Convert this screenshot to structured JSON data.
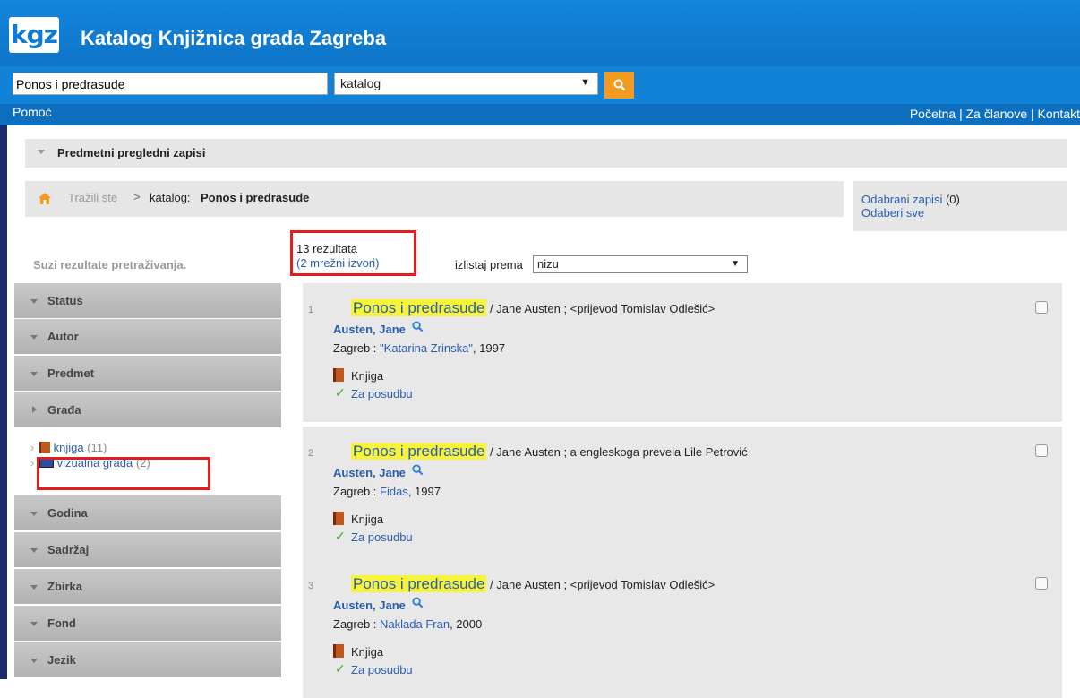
{
  "header": {
    "logo_text": "kgz",
    "title": "Katalog Knjižnica grada Zagreba"
  },
  "search": {
    "query": "Ponos i predrasude",
    "scope": "katalog",
    "button_icon": "search-icon"
  },
  "nav": {
    "help": "Pomoć",
    "links": "Početna | Za članove | Kontakt"
  },
  "subject_bar": {
    "label": "Predmetni pregledni zapisi"
  },
  "breadcrumb": {
    "prefix": "Tražili ste",
    "separator": ">",
    "scope": "katalog:",
    "term": "Ponos i predrasude"
  },
  "selection": {
    "selected_label": "Odabrani zapisi",
    "selected_count": "(0)",
    "select_all": "Odaberi sve"
  },
  "results": {
    "narrow_label": "Suzi rezultate pretraživanja.",
    "count": "13 rezultata",
    "network_sources": "(2 mrežni izvori)",
    "sort_label": "izlistaj prema",
    "sort_value": "nizu"
  },
  "facets": {
    "status": "Status",
    "autor": "Autor",
    "predmet": "Predmet",
    "grada": "Građa",
    "godina": "Godina",
    "sadrzaj": "Sadržaj",
    "zbirka": "Zbirka",
    "fond": "Fond",
    "jezik": "Jezik"
  },
  "grada_items": [
    {
      "label": "knjiga",
      "count": "(11)"
    },
    {
      "label": "vizualna građa",
      "count": "(2)"
    }
  ],
  "records": [
    {
      "num": "1",
      "title": "Ponos i predrasude",
      "statement": " / Jane Austen ; <prijevod Tomislav Odlešić>",
      "author": "Austen, Jane",
      "place": "Zagreb : ",
      "publisher": "\"Katarina Zrinska\"",
      "year": ", 1997",
      "type": "Knjiga",
      "availability": "Za posudbu"
    },
    {
      "num": "2",
      "title": "Ponos i predrasude",
      "statement": " / Jane Austen ; a engleskoga prevela Lile Petrović",
      "author": "Austen, Jane",
      "place": "Zagreb : ",
      "publisher": "Fidas",
      "year": ", 1997",
      "type": "Knjiga",
      "availability": "Za posudbu"
    },
    {
      "num": "3",
      "title": "Ponos i predrasude",
      "statement": " / Jane Austen ; <prijevod Tomislav Odlešić>",
      "author": "Austen, Jane",
      "place": "Zagreb : ",
      "publisher": "Naklada Fran",
      "year": ", 2000",
      "type": "Knjiga",
      "availability": "Za posudbu"
    }
  ],
  "colors": {
    "header_blue": "#0f7bd1",
    "accent_orange": "#f39a21",
    "highlight_yellow": "#f7f23a",
    "annotation_red": "#e21b1b",
    "link_blue": "#2a5db0"
  }
}
